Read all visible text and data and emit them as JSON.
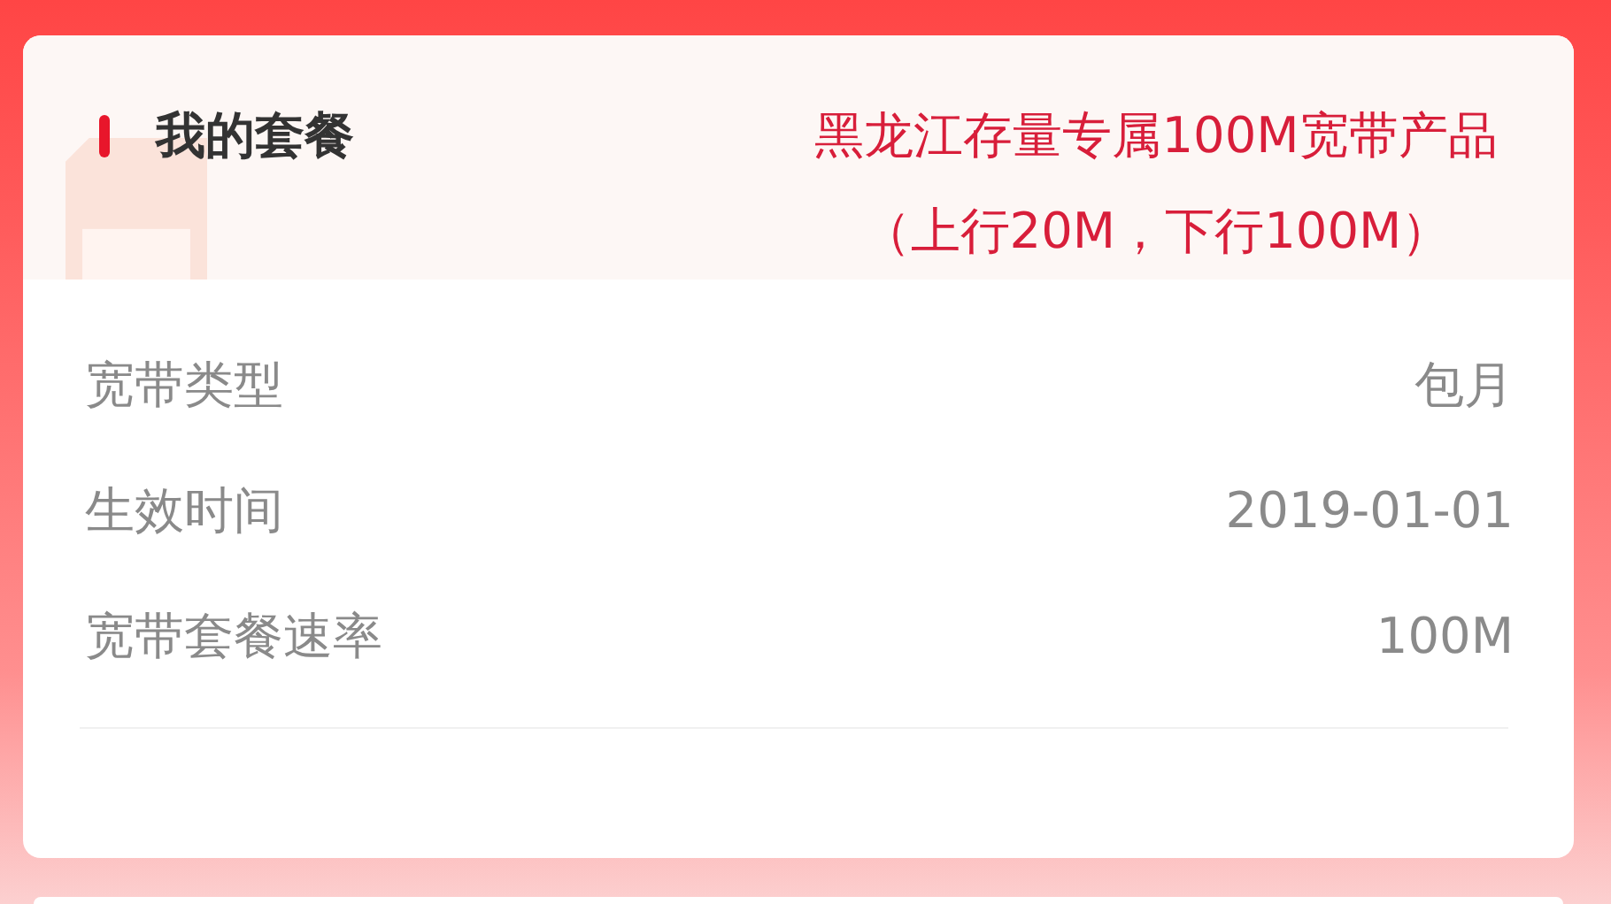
{
  "card": {
    "title": "我的套餐",
    "plan_name": "黑龙江存量专属100M宽带产品（上行20M，下行100M）",
    "rows": [
      {
        "label": "宽带类型",
        "value": "包月"
      },
      {
        "label": "生效时间",
        "value": "2019-01-01"
      },
      {
        "label": "宽带套餐速率",
        "value": "100M"
      }
    ]
  }
}
